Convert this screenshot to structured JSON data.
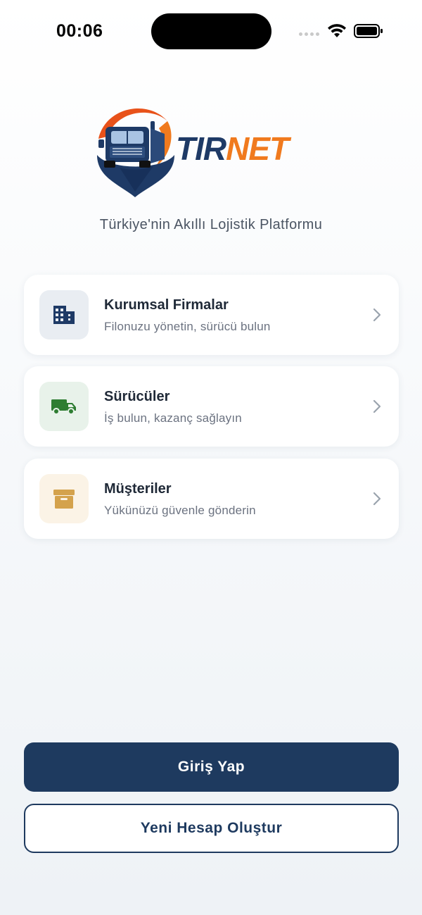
{
  "status_bar": {
    "time": "00:06"
  },
  "brand": {
    "name_part1": "TIR",
    "name_part2": "NET",
    "tagline": "Türkiye'nin Akıllı Lojistik Platformu",
    "colors": {
      "navy": "#1e3a66",
      "orange": "#f07a1e"
    }
  },
  "cards": [
    {
      "title": "Kurumsal Firmalar",
      "subtitle": "Filonuzu yönetin, sürücü bulun",
      "icon": "building-icon",
      "icon_color": "#1e3a66",
      "icon_bg": "#e9edf2"
    },
    {
      "title": "Sürücüler",
      "subtitle": "İş bulun, kazanç sağlayın",
      "icon": "truck-icon",
      "icon_color": "#2e7d32",
      "icon_bg": "#e8f2ea"
    },
    {
      "title": "Müşteriler",
      "subtitle": "Yükünüzü güvenle gönderin",
      "icon": "box-icon",
      "icon_color": "#d4a24c",
      "icon_bg": "#fbf3e6"
    }
  ],
  "buttons": {
    "login": "Giriş Yap",
    "register": "Yeni Hesap Oluştur"
  },
  "colors": {
    "primary": "#1e3a5f"
  }
}
